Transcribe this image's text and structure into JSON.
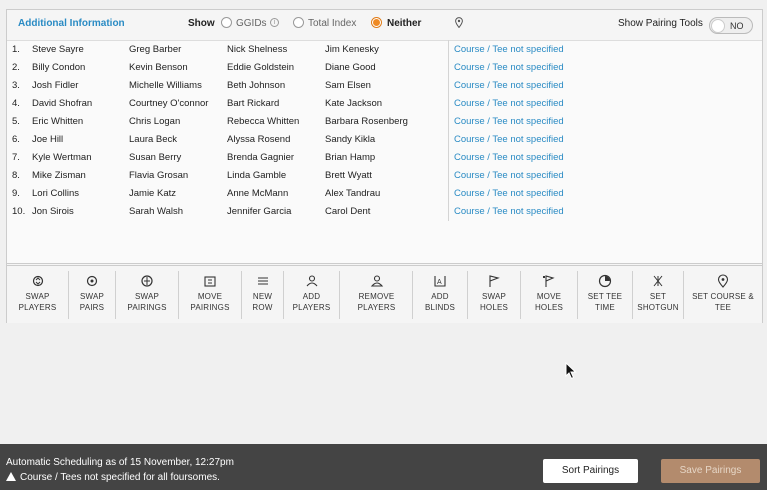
{
  "header": {
    "title": "Additional Information",
    "show_label": "Show",
    "options": [
      {
        "label": "GGIDs",
        "selected": false
      },
      {
        "label": "Total Index",
        "selected": false
      },
      {
        "label": "Neither",
        "selected": true
      }
    ],
    "info_glyph": "i",
    "pairing_tools_label": "Show Pairing Tools",
    "pairing_tools_state": "NO"
  },
  "rows": [
    {
      "num": "1.",
      "p1": "Steve Sayre",
      "p2": "Greg Barber",
      "p3": "Nick Shelness",
      "p4": "Jim Kenesky",
      "course": "Course / Tee not specified"
    },
    {
      "num": "2.",
      "p1": "Billy Condon",
      "p2": "Kevin Benson",
      "p3": "Eddie Goldstein",
      "p4": "Diane Good",
      "course": "Course / Tee not specified"
    },
    {
      "num": "3.",
      "p1": "Josh Fidler",
      "p2": "Michelle Williams",
      "p3": "Beth Johnson",
      "p4": "Sam Elsen",
      "course": "Course / Tee not specified"
    },
    {
      "num": "4.",
      "p1": "David Shofran",
      "p2": "Courtney O'connor",
      "p3": "Bart Rickard",
      "p4": "Kate Jackson",
      "course": "Course / Tee not specified"
    },
    {
      "num": "5.",
      "p1": "Eric Whitten",
      "p2": "Chris Logan",
      "p3": "Rebecca Whitten",
      "p4": "Barbara Rosenberg",
      "course": "Course / Tee not specified"
    },
    {
      "num": "6.",
      "p1": "Joe Hill",
      "p2": "Laura Beck",
      "p3": "Alyssa Rosend",
      "p4": "Sandy Kikla",
      "course": "Course / Tee not specified"
    },
    {
      "num": "7.",
      "p1": "Kyle Wertman",
      "p2": "Susan Berry",
      "p3": "Brenda Gagnier",
      "p4": "Brian Hamp",
      "course": "Course / Tee not specified"
    },
    {
      "num": "8.",
      "p1": "Mike Zisman",
      "p2": "Flavia Grosan",
      "p3": "Linda Gamble",
      "p4": "Brett Wyatt",
      "course": "Course / Tee not specified"
    },
    {
      "num": "9.",
      "p1": "Lori Collins",
      "p2": "Jamie Katz",
      "p3": "Anne McMann",
      "p4": "Alex Tandrau",
      "course": "Course / Tee not specified"
    },
    {
      "num": "10.",
      "p1": "Jon Sirois",
      "p2": "Sarah Walsh",
      "p3": "Jennifer Garcia",
      "p4": "Carol Dent",
      "course": "Course / Tee not specified"
    }
  ],
  "tools": [
    {
      "line1": "SWAP",
      "line2": "PLAYERS",
      "icon": "swap-players-icon"
    },
    {
      "line1": "SWAP",
      "line2": "PAIRS",
      "icon": "swap-pairs-icon"
    },
    {
      "line1": "SWAP",
      "line2": "PAIRINGS",
      "icon": "swap-pairings-icon"
    },
    {
      "line1": "MOVE",
      "line2": "PAIRINGS",
      "icon": "move-pairings-icon"
    },
    {
      "line1": "NEW",
      "line2": "ROW",
      "icon": "new-row-icon"
    },
    {
      "line1": "ADD",
      "line2": "PLAYERS",
      "icon": "add-players-icon"
    },
    {
      "line1": "REMOVE",
      "line2": "PLAYERS",
      "icon": "remove-players-icon"
    },
    {
      "line1": "ADD",
      "line2": "BLINDS",
      "icon": "add-blinds-icon"
    },
    {
      "line1": "SWAP",
      "line2": "HOLES",
      "icon": "swap-holes-icon"
    },
    {
      "line1": "MOVE",
      "line2": "HOLES",
      "icon": "move-holes-icon"
    },
    {
      "line1": "SET TEE",
      "line2": "TIME",
      "icon": "clock-icon"
    },
    {
      "line1": "SET",
      "line2": "SHOTGUN",
      "icon": "shotgun-icon"
    },
    {
      "line1": "SET COURSE &",
      "line2": "TEE",
      "icon": "location-pin-icon"
    }
  ],
  "footer": {
    "status": "Automatic Scheduling as of 15 November, 12:27pm",
    "warning": "Course / Tees not specified for all foursomes.",
    "sort_label": "Sort Pairings",
    "save_label": "Save Pairings"
  },
  "colors": {
    "accent_blue": "#2a8bc4",
    "radio_selected": "#ef8a24",
    "footer_bg": "#444444",
    "save_button": "#b38b6d"
  }
}
